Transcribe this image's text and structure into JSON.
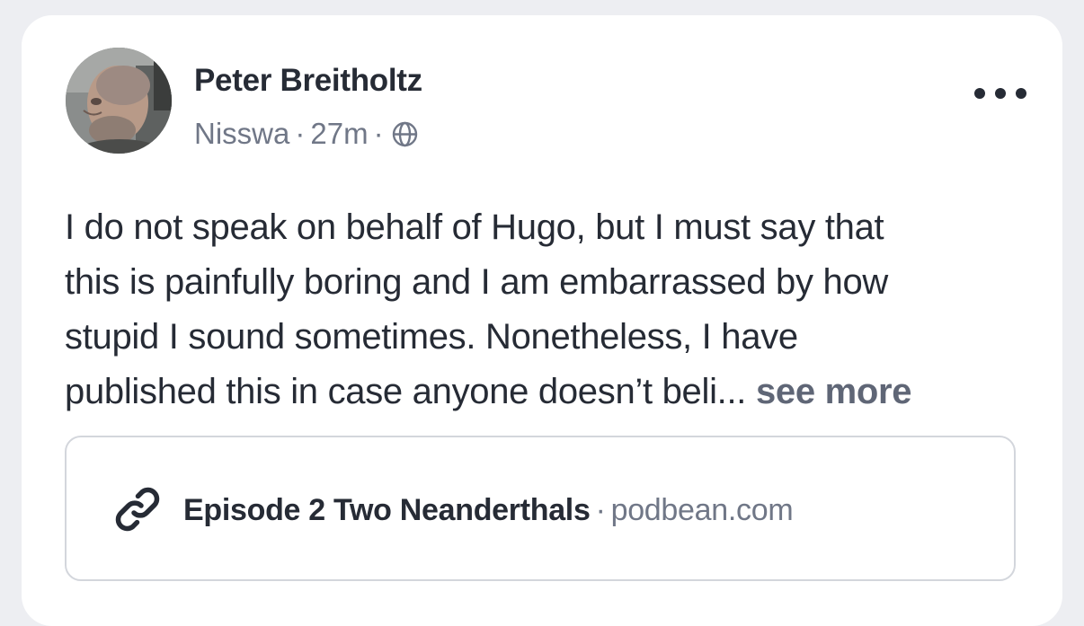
{
  "post": {
    "author": {
      "name": "Peter Breitholtz",
      "avatar": "profile-photo"
    },
    "meta": {
      "location": "Nisswa",
      "separator": "·",
      "time": "27m",
      "visibility_icon": "globe-icon"
    },
    "more_icon": "more-horizontal-icon",
    "body_lines": [
      "I do not speak on behalf of Hugo, but I must say that",
      "this is painfully boring and I am embarrassed by how",
      "stupid I sound sometimes. Nonetheless, I have",
      "published this in case anyone doesn’t beli..."
    ],
    "see_more_label": "see more",
    "link_preview": {
      "icon": "link-icon",
      "title": "Episode 2 Two Neanderthals",
      "separator": "·",
      "domain": "podbean.com"
    }
  },
  "colors": {
    "page_background": "#edeef2",
    "card_background": "#ffffff",
    "primary_text": "#262b35",
    "secondary_text": "#707787",
    "see_more": "#5f6676",
    "border": "#d3d6dc"
  }
}
